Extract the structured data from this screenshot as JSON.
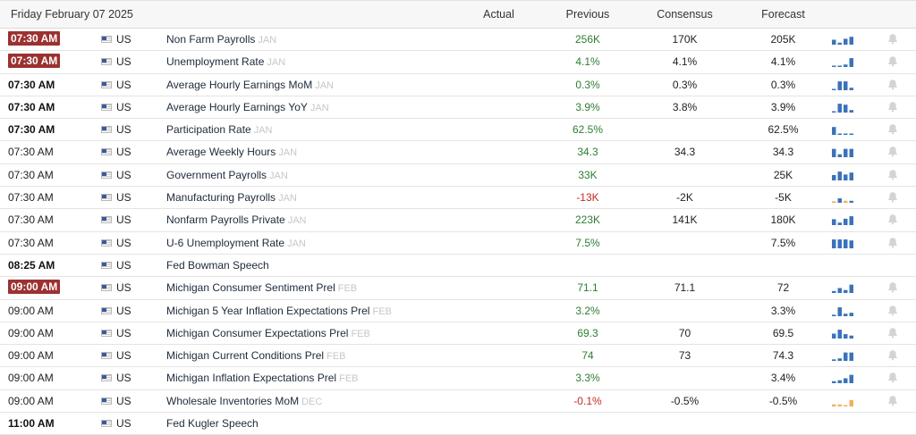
{
  "header": {
    "date": "Friday February 07 2025",
    "col_actual": "Actual",
    "col_previous": "Previous",
    "col_consensus": "Consensus",
    "col_forecast": "Forecast"
  },
  "colors": {
    "badge": "#9c3131",
    "positive": "#2e7d32",
    "negative": "#c62828",
    "spark_blue": "#3b73b9",
    "spark_neg": "#f0b060"
  },
  "events": [
    {
      "time": "07:30 AM",
      "style": "badge",
      "country": "US",
      "name": "Non Farm Payrolls",
      "period": "JAN",
      "previous": "256K",
      "prev_sign": "pos",
      "consensus": "170K",
      "forecast": "205K",
      "spark": [
        0.5,
        0.2,
        0.6,
        0.8
      ],
      "spark_type": "pos"
    },
    {
      "time": "07:30 AM",
      "style": "badge",
      "country": "US",
      "name": "Unemployment Rate",
      "period": "JAN",
      "previous": "4.1%",
      "prev_sign": "pos",
      "consensus": "4.1%",
      "forecast": "4.1%",
      "spark": [
        0.1,
        0.1,
        0.25,
        0.9
      ],
      "spark_type": "pos"
    },
    {
      "time": "07:30 AM",
      "style": "bold",
      "country": "US",
      "name": "Average Hourly Earnings MoM",
      "period": "JAN",
      "previous": "0.3%",
      "prev_sign": "pos",
      "consensus": "0.3%",
      "forecast": "0.3%",
      "spark": [
        0.1,
        0.9,
        0.9,
        0.25
      ],
      "spark_type": "pos"
    },
    {
      "time": "07:30 AM",
      "style": "bold",
      "country": "US",
      "name": "Average Hourly Earnings YoY",
      "period": "JAN",
      "previous": "3.9%",
      "prev_sign": "pos",
      "consensus": "3.8%",
      "forecast": "3.9%",
      "spark": [
        0.1,
        0.9,
        0.8,
        0.25
      ],
      "spark_type": "pos"
    },
    {
      "time": "07:30 AM",
      "style": "bold",
      "country": "US",
      "name": "Participation Rate",
      "period": "JAN",
      "previous": "62.5%",
      "prev_sign": "pos",
      "consensus": "",
      "forecast": "62.5%",
      "spark": [
        0.8,
        0.1,
        0.1,
        0.1
      ],
      "spark_type": "pos"
    },
    {
      "time": "07:30 AM",
      "style": "normal",
      "country": "US",
      "name": "Average Weekly Hours",
      "period": "JAN",
      "previous": "34.3",
      "prev_sign": "pos",
      "consensus": "34.3",
      "forecast": "34.3",
      "spark": [
        0.85,
        0.3,
        0.85,
        0.85
      ],
      "spark_type": "pos"
    },
    {
      "time": "07:30 AM",
      "style": "normal",
      "country": "US",
      "name": "Government Payrolls",
      "period": "JAN",
      "previous": "33K",
      "prev_sign": "pos",
      "consensus": "",
      "forecast": "25K",
      "spark": [
        0.55,
        0.9,
        0.6,
        0.8
      ],
      "spark_type": "pos"
    },
    {
      "time": "07:30 AM",
      "style": "normal",
      "country": "US",
      "name": "Manufacturing Payrolls",
      "period": "JAN",
      "previous": "-13K",
      "prev_sign": "neg",
      "consensus": "-2K",
      "forecast": "-5K",
      "spark": [
        0.15,
        0.45,
        0.2,
        0.2
      ],
      "spark_type": "neg"
    },
    {
      "time": "07:30 AM",
      "style": "normal",
      "country": "US",
      "name": "Nonfarm Payrolls Private",
      "period": "JAN",
      "previous": "223K",
      "prev_sign": "pos",
      "consensus": "141K",
      "forecast": "180K",
      "spark": [
        0.6,
        0.25,
        0.65,
        0.9
      ],
      "spark_type": "pos"
    },
    {
      "time": "07:30 AM",
      "style": "normal",
      "country": "US",
      "name": "U-6 Unemployment Rate",
      "period": "JAN",
      "previous": "7.5%",
      "prev_sign": "pos",
      "consensus": "",
      "forecast": "7.5%",
      "spark": [
        0.9,
        0.9,
        0.9,
        0.8
      ],
      "spark_type": "pos"
    },
    {
      "time": "08:25 AM",
      "style": "bold",
      "country": "US",
      "name": "Fed Bowman Speech",
      "period": "",
      "previous": "",
      "prev_sign": "pos",
      "consensus": "",
      "forecast": "",
      "spark": [],
      "spark_type": "none"
    },
    {
      "time": "09:00 AM",
      "style": "badge",
      "country": "US",
      "name": "Michigan Consumer Sentiment Prel",
      "period": "FEB",
      "previous": "71.1",
      "prev_sign": "pos",
      "consensus": "71.1",
      "forecast": "72",
      "spark": [
        0.2,
        0.5,
        0.3,
        0.85
      ],
      "spark_type": "pos"
    },
    {
      "time": "09:00 AM",
      "style": "normal",
      "country": "US",
      "name": "Michigan 5 Year Inflation Expectations Prel",
      "period": "FEB",
      "previous": "3.2%",
      "prev_sign": "pos",
      "consensus": "",
      "forecast": "3.3%",
      "spark": [
        0.15,
        0.9,
        0.25,
        0.35
      ],
      "spark_type": "pos"
    },
    {
      "time": "09:00 AM",
      "style": "normal",
      "country": "US",
      "name": "Michigan Consumer Expectations Prel",
      "period": "FEB",
      "previous": "69.3",
      "prev_sign": "pos",
      "consensus": "70",
      "forecast": "69.5",
      "spark": [
        0.5,
        0.9,
        0.45,
        0.3
      ],
      "spark_type": "pos"
    },
    {
      "time": "09:00 AM",
      "style": "normal",
      "country": "US",
      "name": "Michigan Current Conditions Prel",
      "period": "FEB",
      "previous": "74",
      "prev_sign": "pos",
      "consensus": "73",
      "forecast": "74.3",
      "spark": [
        0.15,
        0.25,
        0.85,
        0.85
      ],
      "spark_type": "pos"
    },
    {
      "time": "09:00 AM",
      "style": "normal",
      "country": "US",
      "name": "Michigan Inflation Expectations Prel",
      "period": "FEB",
      "previous": "3.3%",
      "prev_sign": "pos",
      "consensus": "",
      "forecast": "3.4%",
      "spark": [
        0.2,
        0.3,
        0.5,
        0.85
      ],
      "spark_type": "pos"
    },
    {
      "time": "09:00 AM",
      "style": "normal",
      "country": "US",
      "name": "Wholesale Inventories MoM",
      "period": "DEC",
      "previous": "-0.1%",
      "prev_sign": "neg",
      "consensus": "-0.5%",
      "forecast": "-0.5%",
      "spark": [
        0.2,
        0.2,
        0.1,
        0.65
      ],
      "spark_type": "neg"
    },
    {
      "time": "11:00 AM",
      "style": "bold",
      "country": "US",
      "name": "Fed Kugler Speech",
      "period": "",
      "previous": "",
      "prev_sign": "pos",
      "consensus": "",
      "forecast": "",
      "spark": [],
      "spark_type": "none"
    }
  ]
}
